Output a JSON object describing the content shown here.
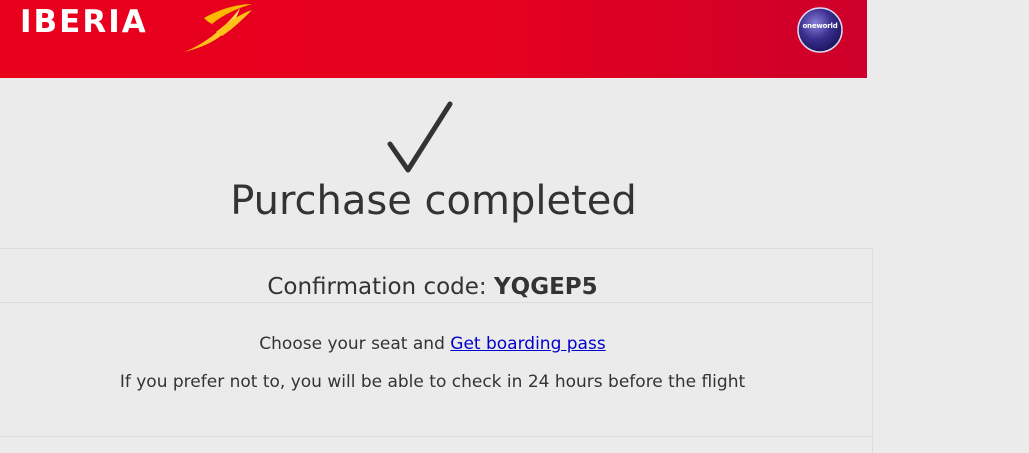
{
  "header": {
    "logo_text": "IBERIA",
    "alliance_logo_text": "oneworld",
    "brand_color": "#e8001d"
  },
  "icons": {
    "logo": "iberia-wing-icon",
    "alliance": "oneworld-globe-icon",
    "status": "checkmark-icon"
  },
  "main": {
    "title": "Purchase completed",
    "confirmation_label": "Confirmation code:",
    "confirmation_code": "YQGEP5",
    "seat_prefix": "Choose your seat and",
    "seat_link": "Get boarding pass",
    "checkin_note": "If you prefer not to, you will be able to check in 24 hours before the flight"
  }
}
